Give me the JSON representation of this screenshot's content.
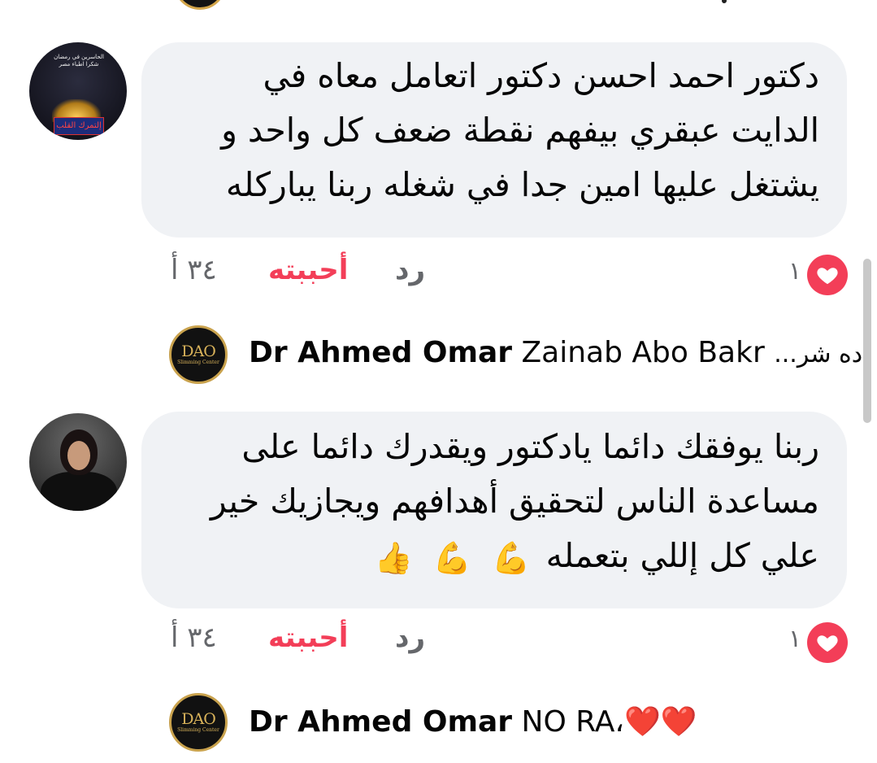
{
  "comments": [
    {
      "text_lines": [
        "دكتور احمد احسن دكتور اتعامل معاه في",
        "الدايت عبقري بيفهم نقطة ضعف كل واحد و",
        "يشتغل عليها امين جدا في شغله ربنا يباركله"
      ],
      "avatar_text": [
        "الحاسرين في رمضان",
        "شكرا اطباء مصر",
        "إلتمرك القلب"
      ],
      "actions": {
        "reply": "رد",
        "like": "أحببته",
        "time": "٣٤ أ",
        "reaction_count": "١"
      }
    },
    {
      "text_lines": [
        "ربنا يوفقك دائما يادكتور ويقدرك دائما على",
        "مساعدة الناس لتحقيق أهدافهم ويجازيك خير",
        "علي كل إللي بتعمله"
      ],
      "emojis": [
        "💪",
        "💪",
        "👍"
      ],
      "actions": {
        "reply": "رد",
        "like": "أحببته",
        "time": "٣٤ أ",
        "reaction_count": "١"
      }
    }
  ],
  "replies": [
    {
      "author": "Dr Ahmed Omar",
      "preview": "Zainab Abo Bakr",
      "suffix": "...ده شر",
      "logo_text": "DAO",
      "logo_sub": "Slimming Center"
    },
    {
      "author": "Dr Ahmed Omar",
      "preview": "NO RA",
      "suffix": "،",
      "hearts": "❤️❤️",
      "logo_text": "DAO",
      "logo_sub": "Slimming Center"
    }
  ],
  "colors": {
    "bubble": "#f0f2f5",
    "like_red": "#f33e58",
    "meta_gray": "#65676b"
  },
  "icons": {
    "reaction": "heart-icon",
    "logo": "dao-logo"
  }
}
